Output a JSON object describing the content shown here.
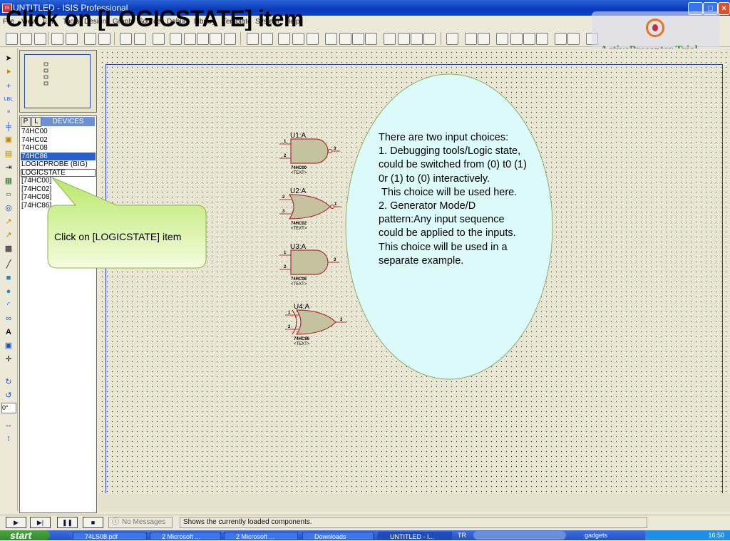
{
  "window": {
    "title": "UNTITLED - ISIS Professional",
    "app_icon": "isis-icon",
    "controls": [
      "minimize",
      "maximize",
      "close"
    ]
  },
  "caption": "Click on [LOGICSTATE] item",
  "menu": [
    "File",
    "View",
    "Edit",
    "Tools",
    "Design",
    "Graph",
    "Source",
    "Debug",
    "Library",
    "Template",
    "System",
    "Help"
  ],
  "watermark": {
    "text": "ActivePresenter Trial"
  },
  "device_panel": {
    "tab_p": "P",
    "tab_l": "L",
    "header": "DEVICES",
    "items": [
      "74HC00",
      "74HC02",
      "74HC08",
      "74HC86",
      "LOGICPROBE (BIG)",
      "LOGICSTATE",
      "[74HC00]",
      "[74HC02]",
      "[74HC08]",
      "[74HC86]"
    ],
    "selected_index": 3,
    "focused_index": 5
  },
  "rotation": "0°",
  "callout": {
    "text": "Click on [LOGICSTATE] item"
  },
  "note": {
    "paragraphs": [
      "There are two input choices:",
      "1. Debugging tools/Logic state, could be switched from (0) t0 (1) 0r (1) to (0) interactively.",
      " This choice will be used here.",
      "2. Generator Mode/D pattern:Any input sequence could be applied to the inputs.",
      "This choice will be used in a separate example."
    ]
  },
  "gates": [
    {
      "ref": "U1:A",
      "part": "74HC00",
      "text": "<TEXT>",
      "type": "nand",
      "pins": [
        "1",
        "2",
        "3"
      ]
    },
    {
      "ref": "U2:A",
      "part": "74HC02",
      "text": "<TEXT>",
      "type": "nor",
      "pins": [
        "2",
        "3",
        "1"
      ]
    },
    {
      "ref": "U3:A",
      "part": "74HC08",
      "text": "<TEXT>",
      "type": "and",
      "pins": [
        "1",
        "2",
        "3"
      ]
    },
    {
      "ref": "U4:A",
      "part": "74HC86",
      "text": "<TEXT>",
      "type": "xor",
      "pins": [
        "1",
        "2",
        "3"
      ]
    }
  ],
  "status": {
    "messages": "No Messages",
    "text": "Shows the currently loaded components."
  },
  "taskbar": {
    "start": "start",
    "tasks": [
      "74LS08.pdf",
      "2 Microsoft ...",
      "2 Microsoft ...",
      "Downloads",
      "UNTITLED - I..."
    ],
    "tray_lang": "TR",
    "tray_gadgets": "gadgets",
    "clock": "16:50"
  }
}
